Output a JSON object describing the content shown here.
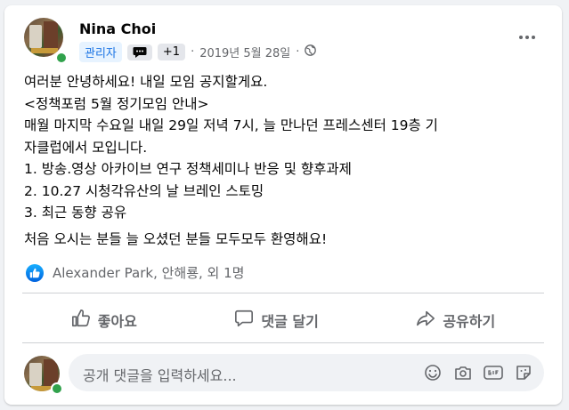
{
  "post": {
    "author": "Nina Choi",
    "role_badge": "관리자",
    "extra_badge_count": "+1",
    "date": "2019년 5월 28일",
    "separator": "·",
    "body_lines": [
      "여러분 안녕하세요! 내일 모임 공지할게요.",
      "<정책포럼 5월 정기모임 안내>",
      "매월 마지막 수요일 내일 29일 저녁 7시, 늘 만나던 프레스센터 19층 기",
      "자클럽에서 모입니다.",
      "1. 방송.영상 아카이브 연구 정책세미나 반응 및 향후과제",
      "2. 10.27 시청각유산의 날 브레인 스토밍",
      "3. 최근 동향 공유"
    ],
    "body_closing": "처음 오시는 분들 늘 오셨던 분들 모두모두 환영해요!",
    "reactions_text": "Alexander Park, 안해룡, 외 1명"
  },
  "actions": {
    "like": "좋아요",
    "comment": "댓글 달기",
    "share": "공유하기"
  },
  "comment": {
    "placeholder": "공개 댓글을 입력하세요..."
  },
  "icons": {
    "more": "more-horizontal-icon",
    "globe": "globe-icon",
    "chat_badge": "chat-bubble-icon",
    "like": "thumbs-up-icon",
    "comment": "comment-icon",
    "share": "share-icon",
    "emoji": "emoji-icon",
    "camera": "camera-icon",
    "gif": "gif-icon",
    "sticker": "sticker-icon"
  },
  "colors": {
    "accent": "#1b74e4",
    "online": "#31a24c",
    "muted": "#65676b"
  }
}
